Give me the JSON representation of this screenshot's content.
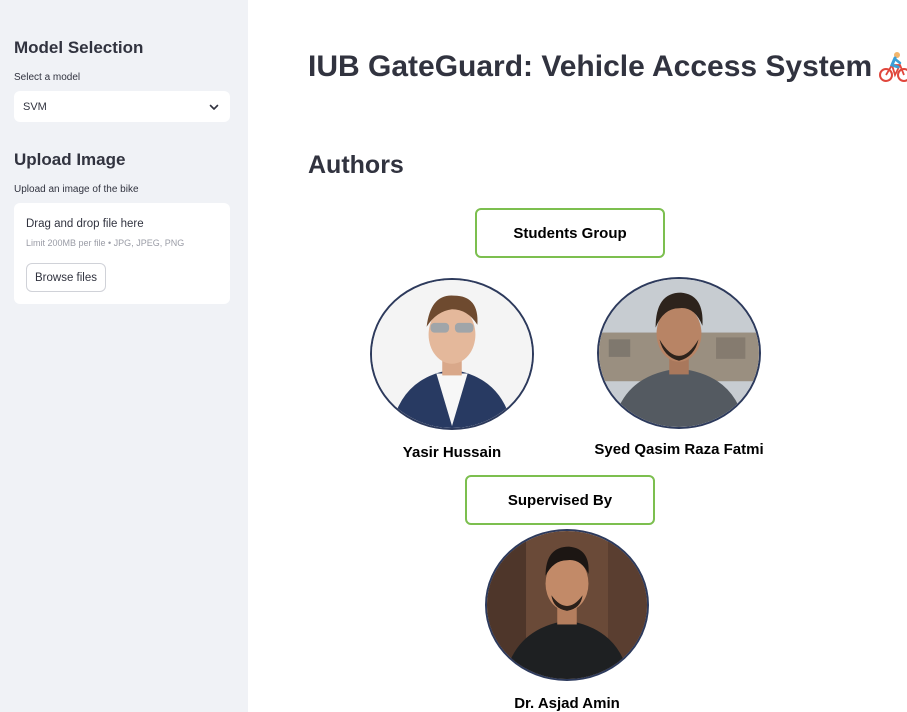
{
  "sidebar": {
    "model_heading": "Model Selection",
    "model_label": "Select a model",
    "model_value": "SVM",
    "upload_heading": "Upload Image",
    "upload_label": "Upload an image of the bike",
    "drop_title": "Drag and drop file here",
    "drop_limit": "Limit 200MB per file • JPG, JPEG, PNG",
    "browse_label": "Browse files"
  },
  "main": {
    "title": "IUB GateGuard: Vehicle Access System",
    "title_icon": "bicyclist-emoji",
    "authors_heading": "Authors",
    "students_group_label": "Students Group",
    "students": [
      {
        "name": "Yasir Hussain"
      },
      {
        "name": "Syed Qasim Raza Fatmi"
      }
    ],
    "supervised_label": "Supervised By",
    "supervisor": {
      "name": "Dr. Asjad Amin"
    }
  },
  "colors": {
    "sidebar_bg": "#f0f2f6",
    "text": "#31333f",
    "box_border": "#7cbf4f",
    "avatar_border": "#2d3a5c"
  }
}
